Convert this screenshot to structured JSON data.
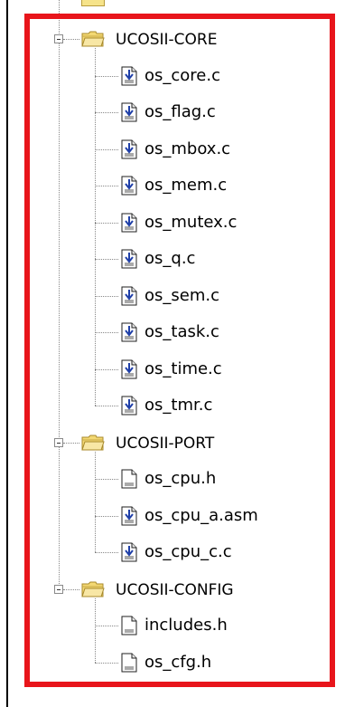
{
  "tree": {
    "groups": [
      {
        "label": "UCOSII-CORE",
        "files": [
          {
            "label": "os_core.c",
            "icon": "c-source-file-icon"
          },
          {
            "label": "os_flag.c",
            "icon": "c-source-file-icon"
          },
          {
            "label": "os_mbox.c",
            "icon": "c-source-file-icon"
          },
          {
            "label": "os_mem.c",
            "icon": "c-source-file-icon"
          },
          {
            "label": "os_mutex.c",
            "icon": "c-source-file-icon"
          },
          {
            "label": "os_q.c",
            "icon": "c-source-file-icon"
          },
          {
            "label": "os_sem.c",
            "icon": "c-source-file-icon"
          },
          {
            "label": "os_task.c",
            "icon": "c-source-file-icon"
          },
          {
            "label": "os_time.c",
            "icon": "c-source-file-icon"
          },
          {
            "label": "os_tmr.c",
            "icon": "c-source-file-icon"
          }
        ]
      },
      {
        "label": "UCOSII-PORT",
        "files": [
          {
            "label": "os_cpu.h",
            "icon": "header-file-icon"
          },
          {
            "label": "os_cpu_a.asm",
            "icon": "c-source-file-icon"
          },
          {
            "label": "os_cpu_c.c",
            "icon": "c-source-file-icon"
          }
        ]
      },
      {
        "label": "UCOSII-CONFIG",
        "files": [
          {
            "label": "includes.h",
            "icon": "header-file-icon"
          },
          {
            "label": "os_cfg.h",
            "icon": "header-file-icon"
          }
        ]
      }
    ]
  },
  "colors": {
    "highlight_border": "#e8151b",
    "folder": "#f3d873",
    "source_icon_accent": "#1f3fa8"
  }
}
